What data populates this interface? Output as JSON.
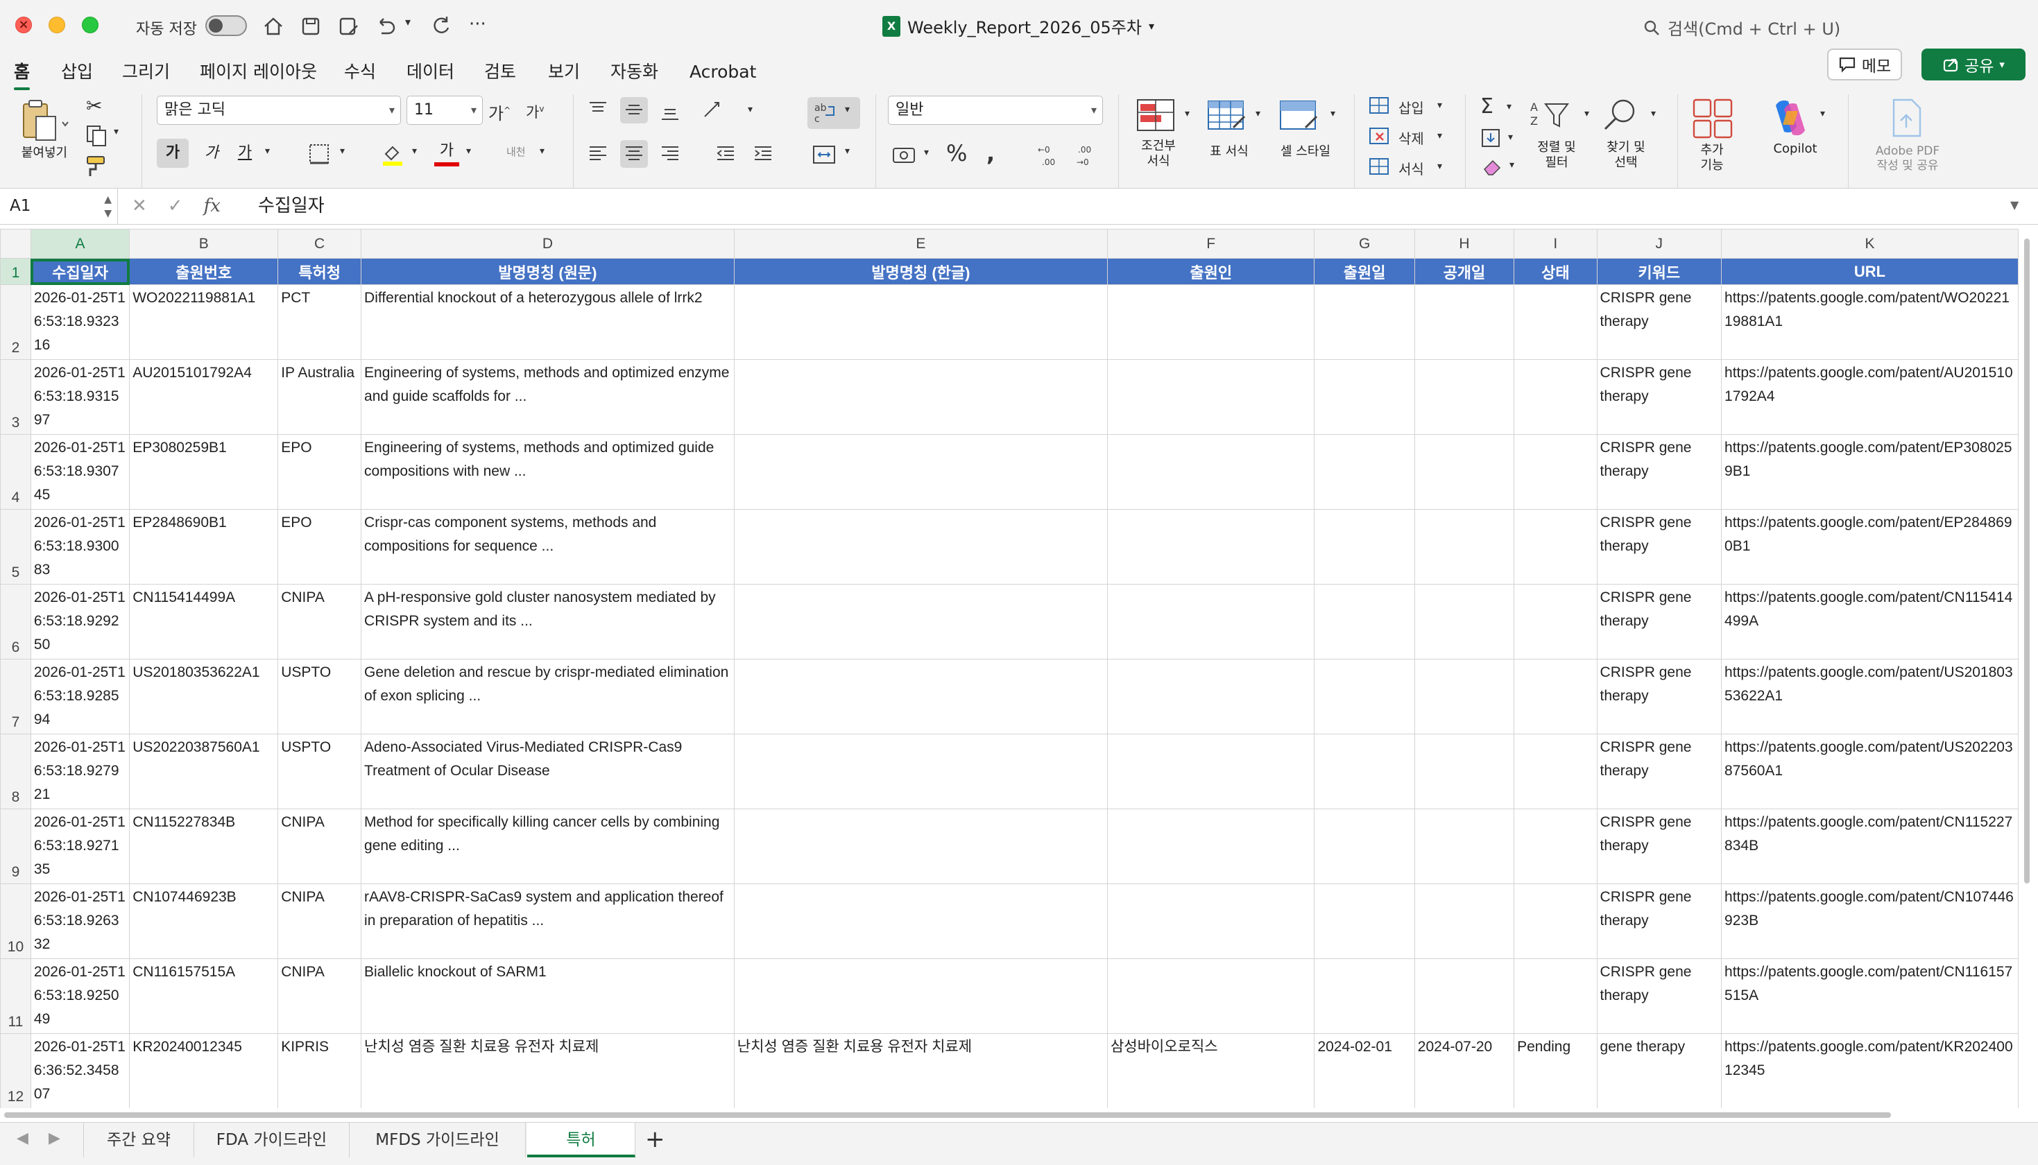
{
  "titlebar": {
    "autosave_label": "자동 저장",
    "doc_title": "Weekly_Report_2026_05주차",
    "search_placeholder": "검색(Cmd + Ctrl + U)"
  },
  "ribbon_tabs": [
    "홈",
    "삽입",
    "그리기",
    "페이지 레이아웃",
    "수식",
    "데이터",
    "검토",
    "보기",
    "자동화",
    "Acrobat"
  ],
  "actions": {
    "memo": "메모",
    "share": "공유"
  },
  "ribbon": {
    "paste": "붙여넣기",
    "font_name": "맑은 고딕",
    "font_size": "11",
    "number_format": "일반",
    "conditional_format": "조건부\n서식",
    "table_format": "표 서식",
    "cell_style": "셀 스타일",
    "insert": "삽입",
    "delete": "삭제",
    "format": "서식",
    "sort_filter": "정렬 및\n필터",
    "find_select": "찾기 및\n선택",
    "addins": "추가\n기능",
    "copilot": "Copilot",
    "adobe_pdf": "Adobe PDF\n작성 및 공유",
    "bold": "가",
    "italic": "가",
    "underline": "가",
    "font_color_glyph": "가",
    "wrap": "내천",
    "increase_font": "가",
    "decrease_font": "가"
  },
  "formula_bar": {
    "name_box": "A1",
    "fx": "fx",
    "value": "수집일자"
  },
  "columns": [
    "A",
    "B",
    "C",
    "D",
    "E",
    "F",
    "G",
    "H",
    "I",
    "J",
    "K"
  ],
  "headers": [
    "수집일자",
    "출원번호",
    "특허청",
    "발명명칭 (원문)",
    "발명명칭 (한글)",
    "출원인",
    "출원일",
    "공개일",
    "상태",
    "키워드",
    "URL"
  ],
  "rows": [
    {
      "n": "2",
      "cells": [
        "2026-01-25T16:53:18.932316",
        "WO2022119881A1",
        "PCT",
        "Differential knockout of a heterozygous allele of lrrk2",
        "",
        "",
        "",
        "",
        "",
        "CRISPR gene therapy",
        "https://patents.google.com/patent/WO2022119881A1"
      ]
    },
    {
      "n": "3",
      "cells": [
        "2026-01-25T16:53:18.931597",
        "AU2015101792A4",
        "IP Australia",
        "Engineering of systems, methods and optimized enzyme and guide scaffolds for ...",
        "",
        "",
        "",
        "",
        "",
        "CRISPR gene therapy",
        "https://patents.google.com/patent/AU2015101792A4"
      ]
    },
    {
      "n": "4",
      "cells": [
        "2026-01-25T16:53:18.930745",
        "EP3080259B1",
        "EPO",
        "Engineering of systems, methods and optimized guide compositions with new ...",
        "",
        "",
        "",
        "",
        "",
        "CRISPR gene therapy",
        "https://patents.google.com/patent/EP3080259B1"
      ]
    },
    {
      "n": "5",
      "cells": [
        "2026-01-25T16:53:18.930083",
        "EP2848690B1",
        "EPO",
        "Crispr-cas component systems, methods and compositions for sequence ...",
        "",
        "",
        "",
        "",
        "",
        "CRISPR gene therapy",
        "https://patents.google.com/patent/EP2848690B1"
      ]
    },
    {
      "n": "6",
      "cells": [
        "2026-01-25T16:53:18.929250",
        "CN115414499A",
        "CNIPA",
        "A pH-responsive gold cluster nanosystem mediated by CRISPR system and its ...",
        "",
        "",
        "",
        "",
        "",
        "CRISPR gene therapy",
        "https://patents.google.com/patent/CN115414499A"
      ]
    },
    {
      "n": "7",
      "cells": [
        "2026-01-25T16:53:18.928594",
        "US20180353622A1",
        "USPTO",
        "Gene deletion and rescue by crispr-mediated elimination of exon splicing ...",
        "",
        "",
        "",
        "",
        "",
        "CRISPR gene therapy",
        "https://patents.google.com/patent/US20180353622A1"
      ]
    },
    {
      "n": "8",
      "cells": [
        "2026-01-25T16:53:18.927921",
        "US20220387560A1",
        "USPTO",
        "Adeno-Associated Virus-Mediated CRISPR-Cas9 Treatment of Ocular Disease",
        "",
        "",
        "",
        "",
        "",
        "CRISPR gene therapy",
        "https://patents.google.com/patent/US20220387560A1"
      ]
    },
    {
      "n": "9",
      "cells": [
        "2026-01-25T16:53:18.927135",
        "CN115227834B",
        "CNIPA",
        "Method for specifically killing cancer cells by combining gene editing ...",
        "",
        "",
        "",
        "",
        "",
        "CRISPR gene therapy",
        "https://patents.google.com/patent/CN115227834B"
      ]
    },
    {
      "n": "10",
      "cells": [
        "2026-01-25T16:53:18.926332",
        "CN107446923B",
        "CNIPA",
        "rAAV8-CRISPR-SaCas9 system and application thereof in preparation of hepatitis ...",
        "",
        "",
        "",
        "",
        "",
        "CRISPR gene therapy",
        "https://patents.google.com/patent/CN107446923B"
      ]
    },
    {
      "n": "11",
      "cells": [
        "2026-01-25T16:53:18.925049",
        "CN116157515A",
        "CNIPA",
        "Biallelic knockout of SARM1",
        "",
        "",
        "",
        "",
        "",
        "CRISPR gene therapy",
        "https://patents.google.com/patent/CN116157515A"
      ]
    },
    {
      "n": "12",
      "cells": [
        "2026-01-25T16:36:52.345807",
        "KR20240012345",
        "KIPRIS",
        "난치성 염증 질환 치료용 유전자 치료제",
        "난치성 염증 질환 치료용 유전자 치료제",
        "삼성바이오로직스",
        "2024-02-01",
        "2024-07-20",
        "Pending",
        "gene therapy",
        "https://patents.google.com/patent/KR20240012345"
      ]
    }
  ],
  "sheet_tabs": [
    "주간 요약",
    "FDA 가이드라인",
    "MFDS 가이드라인",
    "특허"
  ],
  "colors": {
    "accent": "#107c41",
    "header_fill": "#4472c4"
  }
}
